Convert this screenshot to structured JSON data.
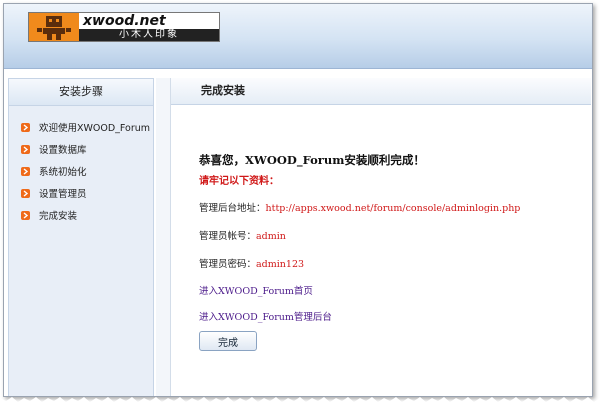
{
  "header": {
    "logo": {
      "name": "xwood-logo",
      "wordmark": "xwood.net",
      "tagline": "小木人印象"
    }
  },
  "sidebar": {
    "title": "安装步骤",
    "steps": [
      {
        "label": "欢迎使用XWOOD_Forum",
        "icon": "arrow-right-icon"
      },
      {
        "label": "设置数据库",
        "icon": "arrow-right-icon"
      },
      {
        "label": "系统初始化",
        "icon": "arrow-right-icon"
      },
      {
        "label": "设置管理员",
        "icon": "arrow-right-icon"
      },
      {
        "label": "完成安装",
        "icon": "arrow-right-icon"
      }
    ]
  },
  "main": {
    "title": "完成安装",
    "congrats": "恭喜您，XWOOD_Forum安装顺利完成！",
    "remember": "请牢记以下资料：",
    "admin_url_label": "管理后台地址：",
    "admin_url": "http://apps.xwood.net/forum/console/adminlogin.php",
    "account_label": "管理员帐号：",
    "account": "admin",
    "password_label": "管理员密码：",
    "password": "admin123",
    "home_link": "进入XWOOD_Forum首页",
    "admin_link": "进入XWOOD_Forum管理后台",
    "finish_button": "完成"
  },
  "colors": {
    "accent_red": "#d01818",
    "link_purple": "#4b1a8a",
    "step_icon_orange": "#ef6a1a",
    "header_blue": "#b6cde7"
  }
}
